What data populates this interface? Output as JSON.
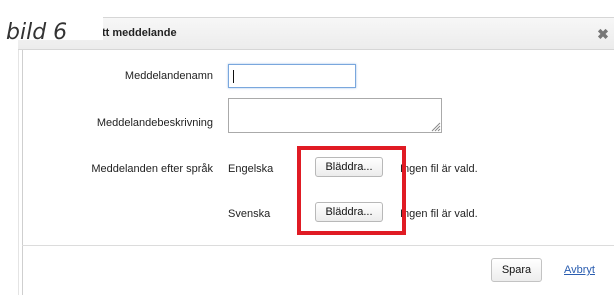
{
  "overlay_tag": "bild 6",
  "dialog": {
    "title": "tt meddelande",
    "close_glyph": "✖"
  },
  "form": {
    "name_label": "Meddelandenamn",
    "name_value": "",
    "description_label": "Meddelandebeskrivning",
    "description_value": "",
    "per_language_label": "Meddelanden efter språk",
    "languages": [
      {
        "name": "Engelska",
        "browse_label": "Bläddra...",
        "file_status": "Ingen fil är vald."
      },
      {
        "name": "Svenska",
        "browse_label": "Bläddra...",
        "file_status": "Ingen fil är vald."
      }
    ]
  },
  "footer": {
    "save_label": "Spara",
    "cancel_label": "Avbryt"
  },
  "icons": {
    "close": "close-icon",
    "resize": "resize-grip-icon"
  },
  "colors": {
    "highlight": "#e01b24",
    "link": "#2a5db0",
    "focus_border": "#7aa7dd"
  }
}
